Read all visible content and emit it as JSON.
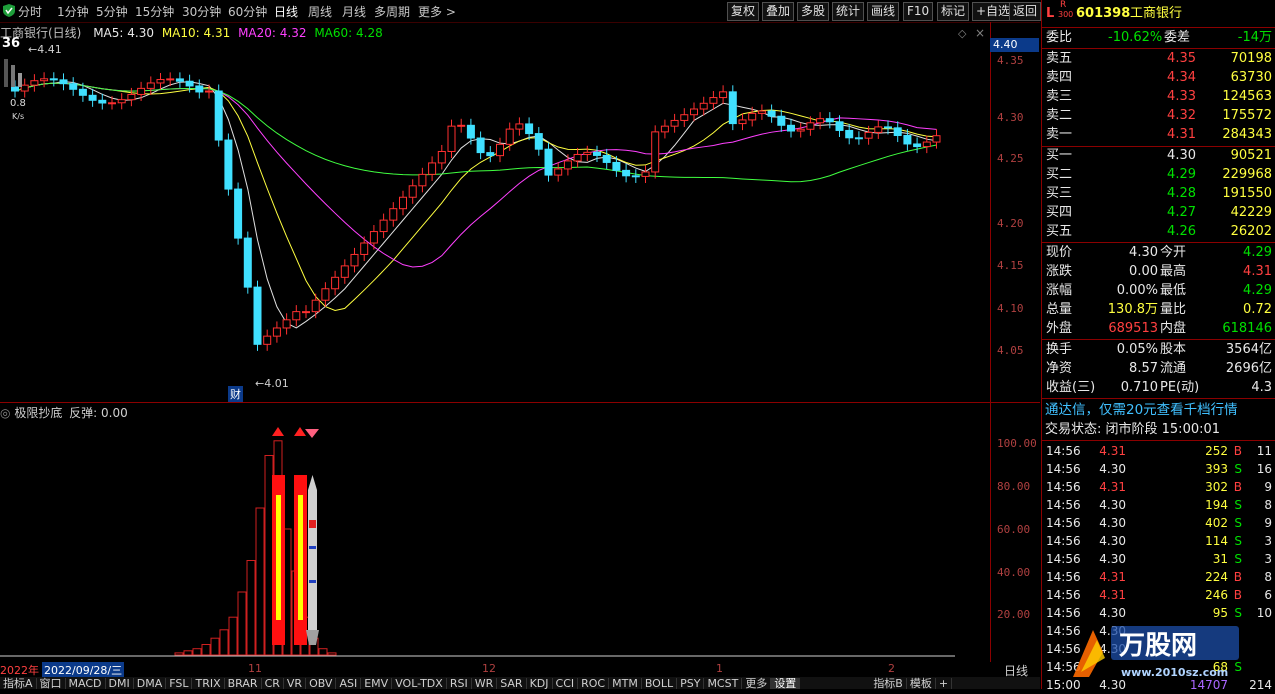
{
  "toolbar": {
    "periods": [
      "分时",
      "1分钟",
      "5分钟",
      "15分钟",
      "30分钟",
      "60分钟",
      "日线",
      "周线",
      "月线",
      "多周期",
      "更多"
    ],
    "buttons": [
      "复权",
      "叠加",
      "多股",
      "统计",
      "画线",
      "F10",
      "标记",
      "+自选",
      "返回"
    ]
  },
  "chart": {
    "title": "工商银行(日线)",
    "ma": {
      "ma5": "MA5: 4.30",
      "ma10": "MA10: 4.31",
      "ma20": "MA20: 4.32",
      "ma60": "MA60: 4.28"
    },
    "current_price_box": "4.40",
    "high_label": "4.41",
    "low_label": "4.01",
    "event_label": "财",
    "badge_number": "36",
    "badge_sub": "0.8",
    "badge_unit": "K/s",
    "price_ticks": [
      "4.35",
      "4.30",
      "4.25",
      "4.20",
      "4.15",
      "4.10",
      "4.05"
    ],
    "colors": {
      "up": "#ff3030",
      "down": "#40e0ff",
      "ma5": "#e0e0e0",
      "ma10": "#ffff40",
      "ma20": "#ff40ff",
      "ma60": "#40ff40"
    }
  },
  "indicator": {
    "name": "极限抄底",
    "param": "反弹: 0.00",
    "ticks": [
      "100.00",
      "80.00",
      "60.00",
      "40.00",
      "20.00"
    ]
  },
  "datebar": {
    "year": "2022年",
    "date": "2022/09/28/三",
    "months": [
      "11",
      "12",
      "1",
      "2"
    ],
    "period_label": "日线"
  },
  "tabs": [
    "指标A",
    "窗口",
    "MACD",
    "DMI",
    "DMA",
    "FSL",
    "TRIX",
    "BRAR",
    "CR",
    "VR",
    "OBV",
    "ASI",
    "EMV",
    "VOL-TDX",
    "RSI",
    "WR",
    "SAR",
    "KDJ",
    "CCI",
    "ROC",
    "MTM",
    "BOLL",
    "PSY",
    "MCST",
    "更多",
    "设置",
    "指标B",
    "模板",
    "+"
  ],
  "stock": {
    "code": "601398",
    "name": "工商银行",
    "market_flag": "L",
    "badge_top": "R",
    "badge_bottom": "300"
  },
  "orderbook": {
    "ratio_label": "委比",
    "ratio_value": "-10.62%",
    "diff_label": "委差",
    "diff_value": "-14万",
    "asks": [
      {
        "label": "卖五",
        "price": "4.35",
        "vol": "70198"
      },
      {
        "label": "卖四",
        "price": "4.34",
        "vol": "63730"
      },
      {
        "label": "卖三",
        "price": "4.33",
        "vol": "124563"
      },
      {
        "label": "卖二",
        "price": "4.32",
        "vol": "175572"
      },
      {
        "label": "卖一",
        "price": "4.31",
        "vol": "284343"
      }
    ],
    "bids": [
      {
        "label": "买一",
        "price": "4.30",
        "vol": "90521"
      },
      {
        "label": "买二",
        "price": "4.29",
        "vol": "229968"
      },
      {
        "label": "买三",
        "price": "4.28",
        "vol": "191550"
      },
      {
        "label": "买四",
        "price": "4.27",
        "vol": "42229"
      },
      {
        "label": "买五",
        "price": "4.26",
        "vol": "26202"
      }
    ]
  },
  "stats": [
    {
      "l1": "现价",
      "v1": "4.30",
      "l2": "今开",
      "v2": "4.29"
    },
    {
      "l1": "涨跌",
      "v1": "0.00",
      "l2": "最高",
      "v2": "4.31"
    },
    {
      "l1": "涨幅",
      "v1": "0.00%",
      "l2": "最低",
      "v2": "4.29"
    },
    {
      "l1": "总量",
      "v1": "130.8万",
      "l2": "量比",
      "v2": "0.72"
    },
    {
      "l1": "外盘",
      "v1": "689513",
      "l2": "内盘",
      "v2": "618146"
    }
  ],
  "fundamentals": [
    {
      "l1": "换手",
      "v1": "0.05%",
      "l2": "股本",
      "v2": "3564亿"
    },
    {
      "l1": "净资",
      "v1": "8.57",
      "l2": "流通",
      "v2": "2696亿"
    },
    {
      "l1": "收益(三)",
      "v1": "0.710",
      "l2": "PE(动)",
      "v2": "4.3"
    }
  ],
  "promo": "通达信，仅需20元查看千档行情",
  "trade_status": "交易状态: 闭市阶段 15:00:01",
  "ticks": [
    {
      "time": "14:56",
      "price": "4.31",
      "vol": "252",
      "side": "B",
      "n": "11"
    },
    {
      "time": "14:56",
      "price": "4.30",
      "vol": "393",
      "side": "S",
      "n": "16"
    },
    {
      "time": "14:56",
      "price": "4.31",
      "vol": "302",
      "side": "B",
      "n": "9"
    },
    {
      "time": "14:56",
      "price": "4.30",
      "vol": "194",
      "side": "S",
      "n": "8"
    },
    {
      "time": "14:56",
      "price": "4.30",
      "vol": "402",
      "side": "S",
      "n": "9"
    },
    {
      "time": "14:56",
      "price": "4.30",
      "vol": "114",
      "side": "S",
      "n": "3"
    },
    {
      "time": "14:56",
      "price": "4.30",
      "vol": "31",
      "side": "S",
      "n": "3"
    },
    {
      "time": "14:56",
      "price": "4.31",
      "vol": "224",
      "side": "B",
      "n": "8"
    },
    {
      "time": "14:56",
      "price": "4.31",
      "vol": "246",
      "side": "B",
      "n": "6"
    },
    {
      "time": "14:56",
      "price": "4.30",
      "vol": "95",
      "side": "S",
      "n": "10"
    },
    {
      "time": "14:56",
      "price": "4.30",
      "vol": "",
      "side": "",
      "n": ""
    },
    {
      "time": "14:56",
      "price": "4.30",
      "vol": "",
      "side": "",
      "n": ""
    },
    {
      "time": "14:56",
      "price": "",
      "vol": "68",
      "side": "S",
      "n": ""
    },
    {
      "time": "15:00",
      "price": "4.30",
      "vol": "14707",
      "side": "",
      "n": "214"
    }
  ],
  "watermark": {
    "text": "万股网",
    "url": "www.2010sz.com"
  }
}
